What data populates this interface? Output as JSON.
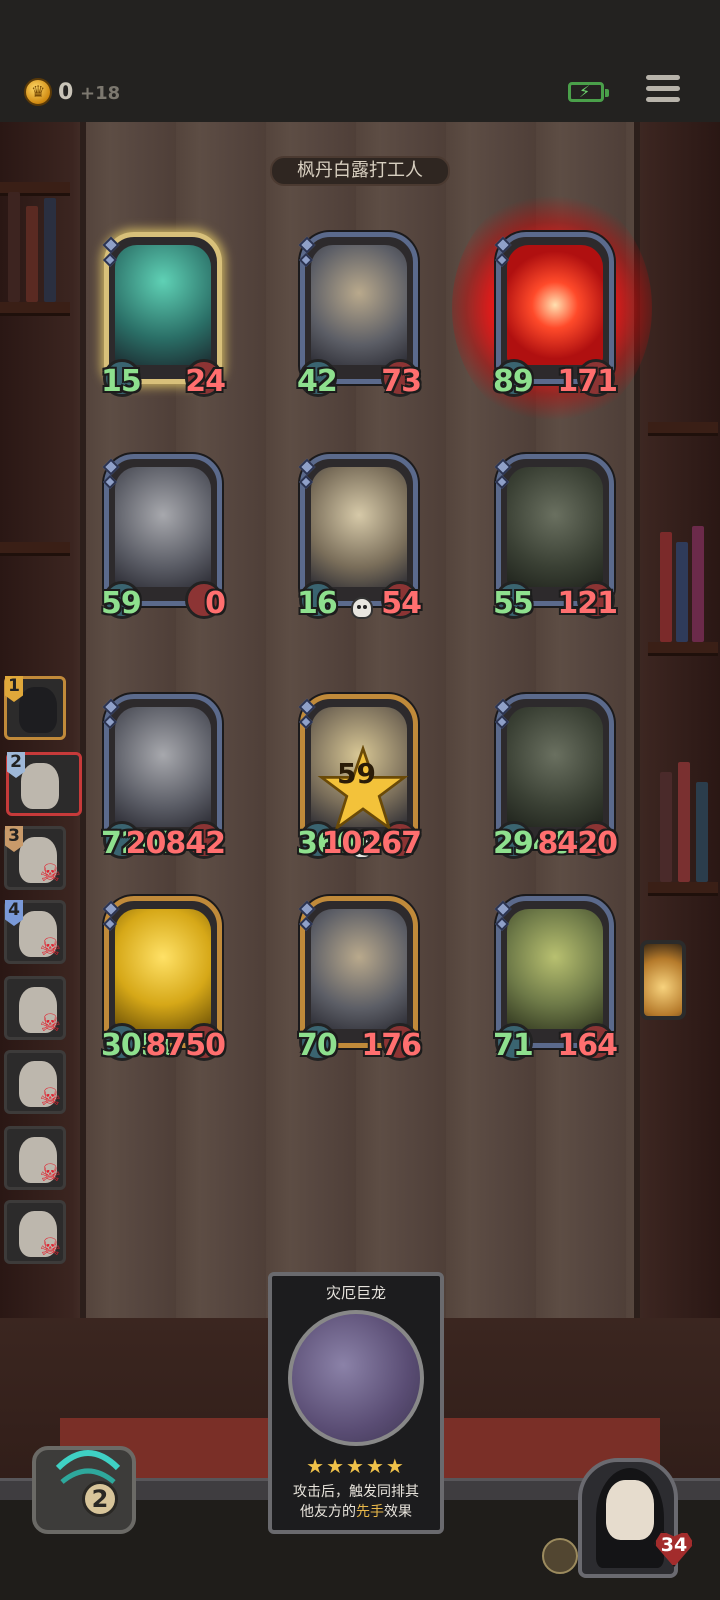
{
  "topbar": {
    "gold_value": "0",
    "gold_income": "+18",
    "menu_icon": "hamburger-menu-icon",
    "battery_icon": "battery-charging-icon"
  },
  "board": {
    "title": "枫丹白露打工人",
    "rows": [
      [
        {
          "name": "ghost-rider",
          "attack": "15",
          "health": "24",
          "style": "glow"
        },
        {
          "name": "horned-beast",
          "attack": "42",
          "health": "73",
          "style": "normal"
        },
        {
          "name": "fire-burst",
          "attack": "89",
          "health": "171",
          "style": "burning"
        }
      ],
      [
        {
          "name": "grey-dragon",
          "attack": "59",
          "health": "0",
          "style": "normal"
        },
        {
          "name": "bone-dragon",
          "attack": "16",
          "health": "54",
          "style": "skull"
        },
        {
          "name": "skull-mage",
          "attack": "55",
          "health": "121",
          "style": "normal"
        }
      ],
      [
        {
          "name": "grey-dragon",
          "attack": "7267",
          "health": "20842",
          "style": "normal"
        },
        {
          "name": "bone-dragon-gold",
          "attack": "3600",
          "health": "10267",
          "star": "59",
          "style": "gold"
        },
        {
          "name": "skull-mage",
          "attack": "2949",
          "health": "8420",
          "style": "normal"
        }
      ],
      [
        {
          "name": "golden-dragon",
          "attack": "3050",
          "health": "8750",
          "style": "gold"
        },
        {
          "name": "horned-beast",
          "attack": "70",
          "health": "176",
          "style": "gold"
        },
        {
          "name": "green-demon",
          "attack": "71",
          "health": "164",
          "style": "normal"
        }
      ]
    ]
  },
  "queue": [
    {
      "badge": "1",
      "state": "active",
      "badge_color": "#e0a83a"
    },
    {
      "badge": "2",
      "state": "selected",
      "badge_color": "#9fb8d8"
    },
    {
      "badge": "3",
      "state": "dead",
      "badge_color": "#c89a6a"
    },
    {
      "badge": "4",
      "state": "dead",
      "badge_color": "#7a9ad8"
    },
    {
      "badge": "",
      "state": "dead"
    },
    {
      "badge": "",
      "state": "dead"
    },
    {
      "badge": "",
      "state": "dead"
    },
    {
      "badge": "",
      "state": "dead"
    }
  ],
  "card_detail": {
    "title": "灾厄巨龙",
    "stars": "★★★★★",
    "desc_line1": "攻击后，触发同排其",
    "desc_line2a": "他友方的",
    "desc_highlight": "先手",
    "desc_line2b": "效果"
  },
  "deck": {
    "count": "2"
  },
  "hero": {
    "health": "34"
  },
  "colors": {
    "attack": "#8ee08e",
    "health": "#ff6f6f",
    "gold_border": "#c08a3a",
    "blue_border": "#5b6a8c"
  }
}
